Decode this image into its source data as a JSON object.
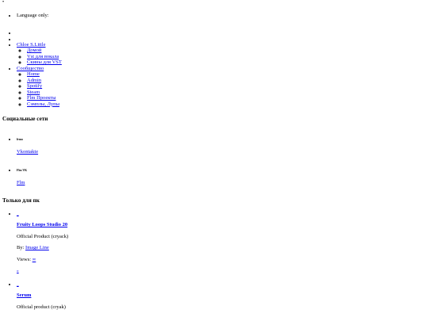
{
  "top_marker": "•",
  "language": {
    "label": "Language only:"
  },
  "nav": {
    "author": {
      "label": "Chloe S.Little",
      "items": [
        "Домой",
        "Vst для вокала",
        "Скины для VST"
      ]
    },
    "community": {
      "label": "Сообщество",
      "items": [
        "Home",
        "Admin",
        "Spotify",
        "Steam",
        "Flm Проекты",
        "Сэмплы, Лупы"
      ]
    }
  },
  "social": {
    "title": "Социальные сети",
    "items": [
      {
        "heading": "frmo",
        "link": "Vkontakte"
      },
      {
        "heading": "Flm VK",
        "link": "Flm"
      }
    ]
  },
  "pc": {
    "title": "Только для пк",
    "items": [
      {
        "thumb": "_",
        "title": "Fruity Loops Studio 20",
        "subtitle": "Official Product (cryack)",
        "by_label": "By:",
        "by_link": "Image Line",
        "views_label": "Views:",
        "views_link": "∞",
        "extra_link": "»"
      },
      {
        "thumb": "_",
        "title": "Serum",
        "subtitle": "Official product (cryak)"
      }
    ]
  }
}
